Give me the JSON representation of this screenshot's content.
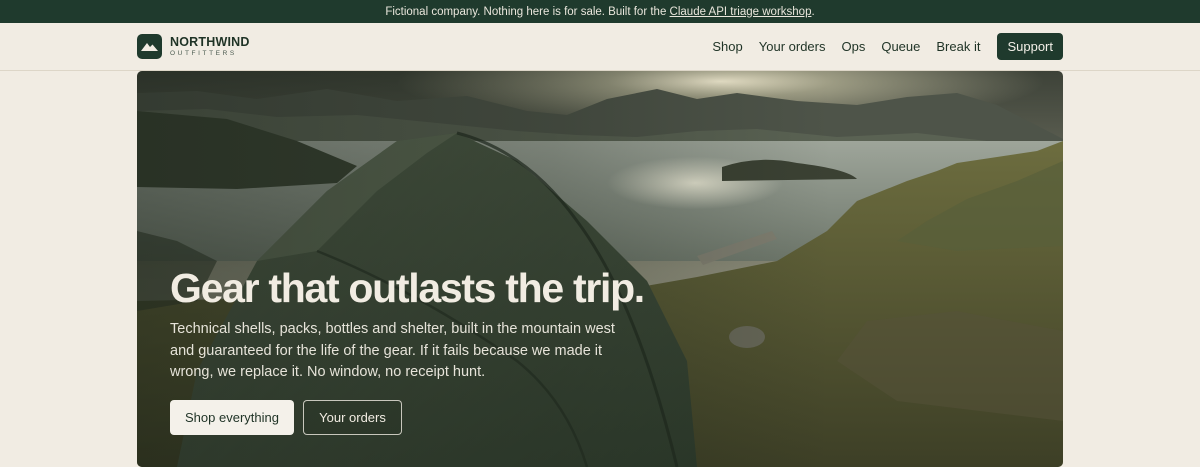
{
  "announcement": {
    "text_before": "Fictional company. Nothing here is for sale. Built for the ",
    "link_label": "Claude API triage workshop",
    "text_after": "."
  },
  "brand": {
    "name": "NORTHWIND",
    "tagline": "OUTFITTERS",
    "logo_icon": "mountain-icon"
  },
  "nav": {
    "links": [
      "Shop",
      "Your orders",
      "Ops",
      "Queue",
      "Break it"
    ],
    "support_label": "Support"
  },
  "hero": {
    "title": "Gear that outlasts the trip.",
    "body": "Technical shells, packs, bottles and shelter, built in the mountain west and guaranteed for the life of the gear. If it fails because we made it wrong, we replace it. No window, no receipt hunt.",
    "primary_cta": "Shop everything",
    "secondary_cta": "Your orders"
  },
  "colors": {
    "forest": "#1f3a2d",
    "cream": "#f1ece3"
  }
}
